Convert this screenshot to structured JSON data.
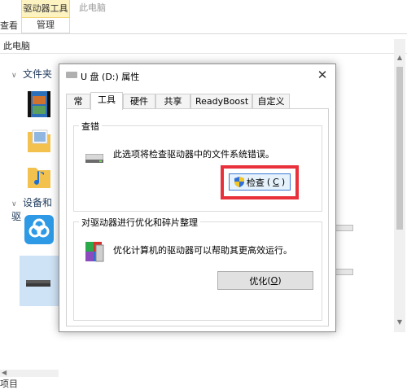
{
  "ribbon": {
    "partial_tab": "查看",
    "tools_tab": "驱动器工具",
    "manage_tab": "管理",
    "pc_tab": "此电脑"
  },
  "address_bar": {
    "path": "此电脑",
    "dropdown_icon": "chevron-down-icon"
  },
  "nav": {
    "folders_header": "文件夹",
    "devices_header": "设备和驱",
    "status_text": "项目"
  },
  "dialog": {
    "title": "U 盘 (D:) 属性",
    "close_glyph": "✕",
    "tabs": [
      "常规",
      "工具",
      "硬件",
      "共享",
      "ReadyBoost",
      "自定义"
    ],
    "active_tab": "工具",
    "error_check": {
      "group_title": "查错",
      "description": "此选项将检查驱动器中的文件系统错误。",
      "button_text": "检查",
      "button_mnemonic": "C"
    },
    "optimize": {
      "group_title": "对驱动器进行优化和碎片整理",
      "description": "优化计算机的驱动器可以帮助其更高效运行。",
      "button_text": "优化",
      "button_mnemonic": "O"
    }
  },
  "colors": {
    "highlight": "#e8313a",
    "tools_tab_bg": "#fdf3c1",
    "focus_button_border": "#3b7bd4"
  }
}
